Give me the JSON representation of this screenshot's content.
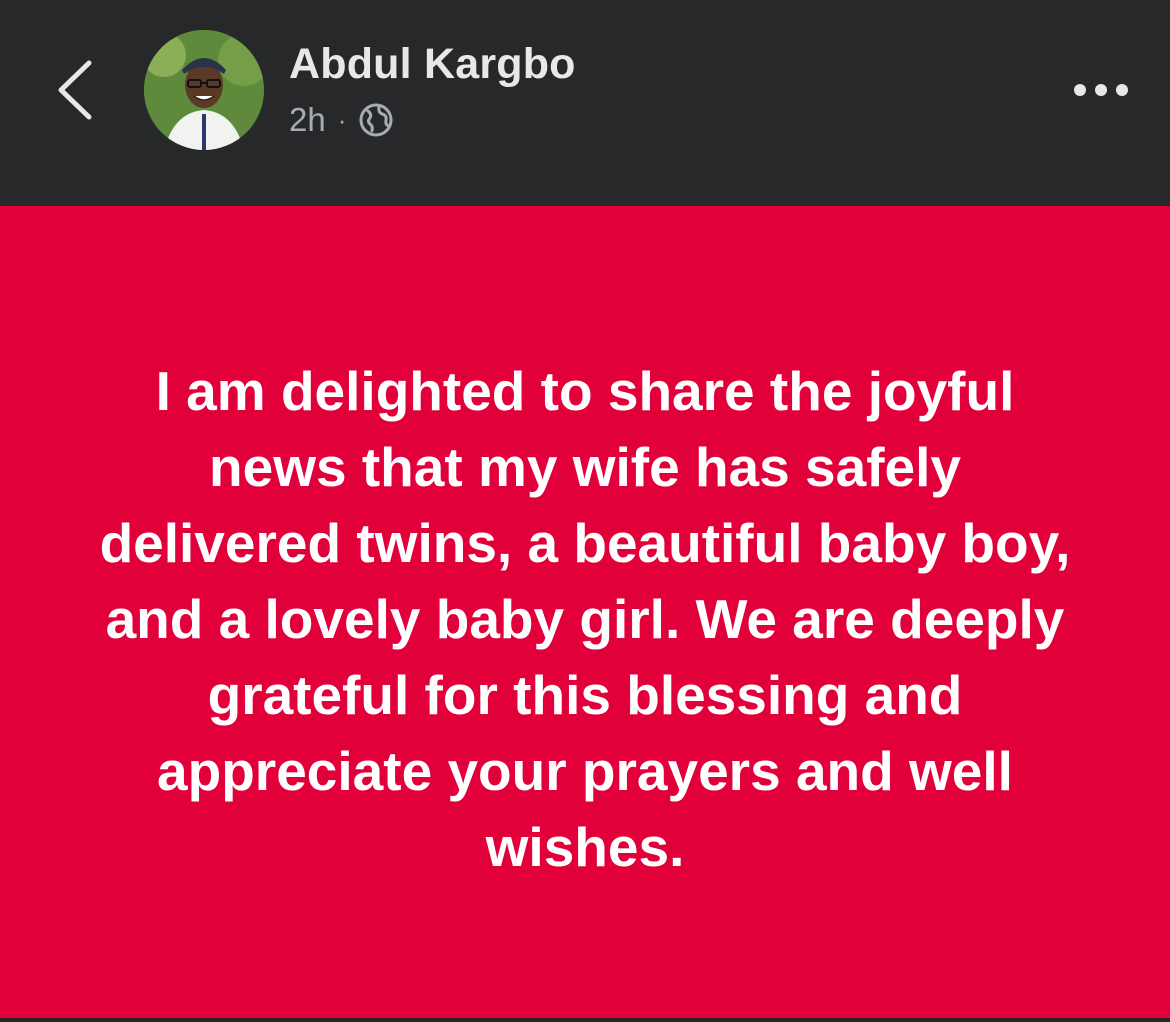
{
  "header": {
    "author_name": "Abdul Kargbo",
    "timestamp": "2h",
    "separator": "·",
    "audience_icon": "globe-icon",
    "back_icon": "chevron-left-icon",
    "more_icon": "more-horizontal-icon"
  },
  "post": {
    "background_color": "#e1003a",
    "text": "I am delighted to share the joyful news that my wife has safely delivered twins, a beautiful baby boy, and a lovely baby girl. We are deeply grateful for this blessing and appreciate your prayers and well wishes."
  }
}
